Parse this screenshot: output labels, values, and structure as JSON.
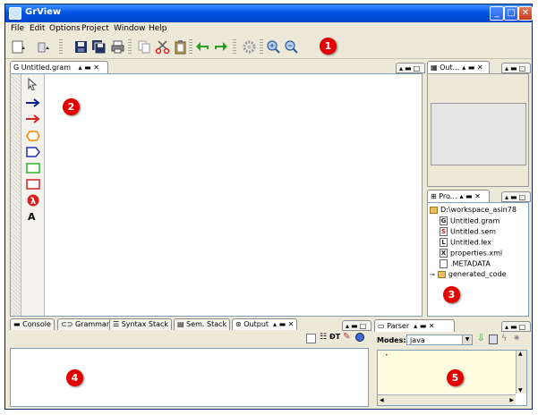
{
  "window": {
    "title": "GrView"
  },
  "menu": [
    "File",
    "Edit",
    "Options",
    "Project",
    "Window",
    "Help"
  ],
  "editor": {
    "tab_label": "Untitled.gram"
  },
  "outline": {
    "tab_label": "Out..."
  },
  "project": {
    "tab_label": "Pro...",
    "items": [
      {
        "label": "D:\\workspace_asin78",
        "icon": "folder-icon"
      },
      {
        "label": "Untitled.gram",
        "icon": "G"
      },
      {
        "label": "Untitled.sem",
        "icon": "S"
      },
      {
        "label": "Untitled.lex",
        "icon": "L"
      },
      {
        "label": "properties.xml",
        "icon": "X"
      },
      {
        "label": ".METADATA",
        "icon": ""
      },
      {
        "label": "generated_code",
        "icon": "folder-icon"
      }
    ]
  },
  "bottom_tabs": [
    "Console",
    "Grammar",
    "Syntax Stack",
    "Sem. Stack",
    "Output"
  ],
  "parser": {
    "tab_label": "Parser",
    "modes_label": "Modes:",
    "mode_value": "java"
  },
  "palette": {
    "text_tool": "A"
  },
  "markers": [
    "1",
    "2",
    "3",
    "4",
    "5"
  ],
  "colors": {
    "accent_red": "#e30000",
    "title_blue": "#0054e3"
  }
}
